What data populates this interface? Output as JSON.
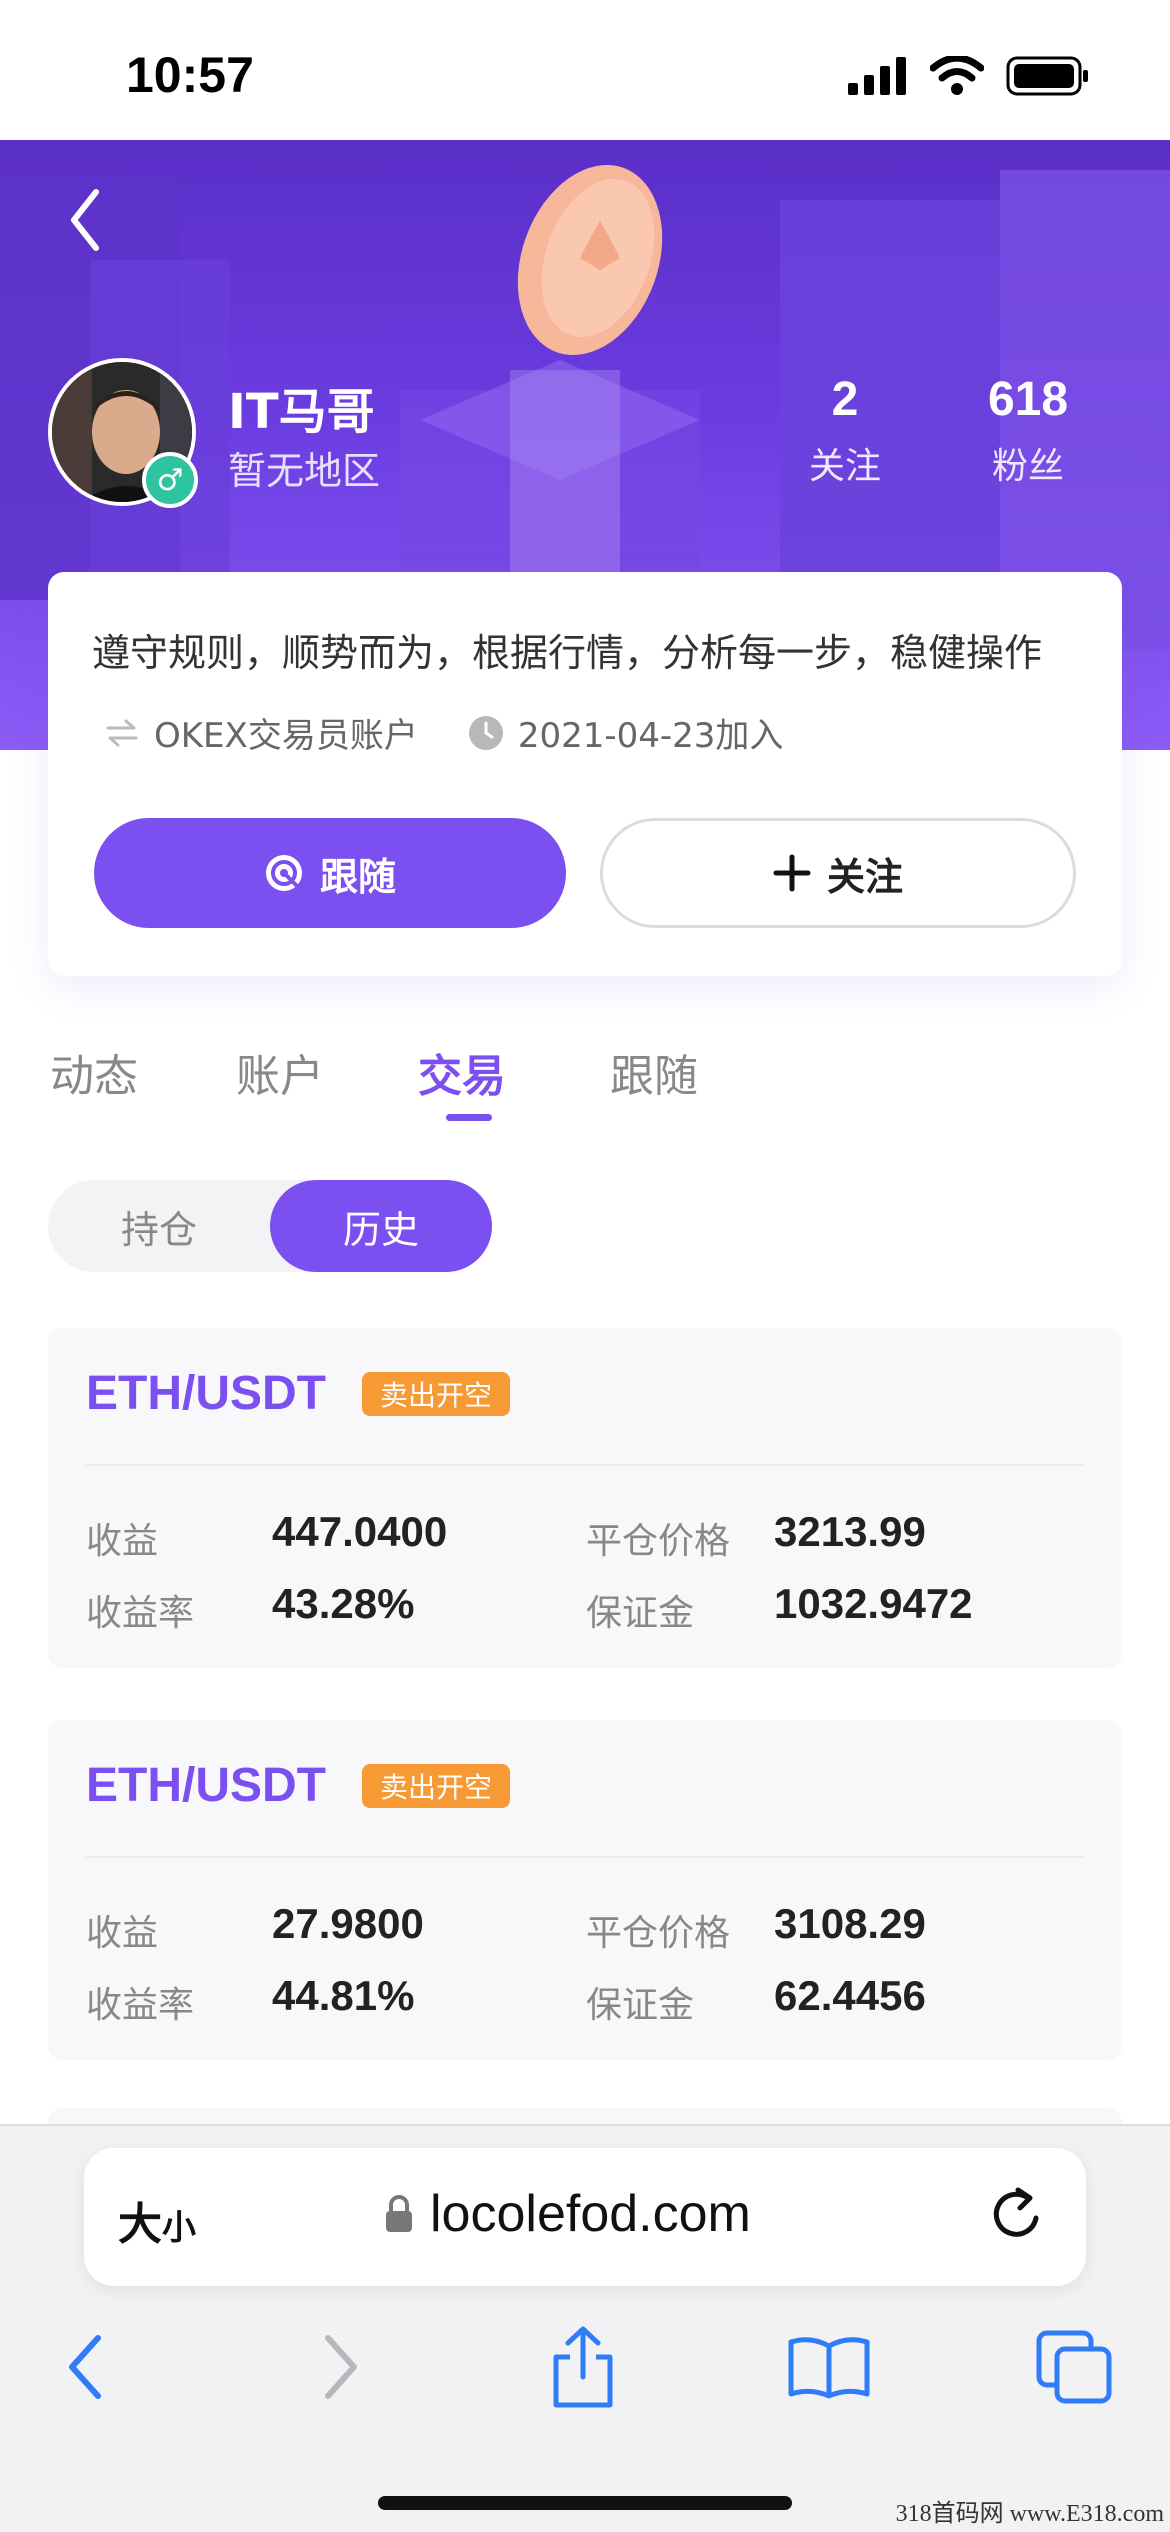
{
  "status_bar": {
    "time": "10:57"
  },
  "profile": {
    "name": "IT马哥",
    "region": "暂无地区",
    "stats": [
      {
        "value": "2",
        "label": "关注"
      },
      {
        "value": "618",
        "label": "粉丝"
      }
    ],
    "bio": "遵守规则，顺势而为，根据行情，分析每一步，稳健操作",
    "account_type": "OKEX交易员账户",
    "joined": "2021-04-23加入",
    "follow_button": "跟随",
    "watch_button": "关注"
  },
  "tabs": [
    {
      "label": "动态"
    },
    {
      "label": "账户"
    },
    {
      "label": "交易"
    },
    {
      "label": "跟随"
    }
  ],
  "active_tab": "交易",
  "segmented": {
    "left": "持仓",
    "right": "历史",
    "active": "历史"
  },
  "trades": [
    {
      "pair": "ETH/USDT",
      "tag": "卖出开空",
      "profit_label": "收益",
      "profit": "447.0400",
      "close_price_label": "平仓价格",
      "close_price": "3213.99",
      "rate_label": "收益率",
      "rate": "43.28%",
      "margin_label": "保证金",
      "margin": "1032.9472"
    },
    {
      "pair": "ETH/USDT",
      "tag": "卖出开空",
      "profit_label": "收益",
      "profit": "27.9800",
      "close_price_label": "平仓价格",
      "close_price": "3108.29",
      "rate_label": "收益率",
      "rate": "44.81%",
      "margin_label": "保证金",
      "margin": "62.4456"
    }
  ],
  "browser": {
    "text_size": "大",
    "text_size_small": "小",
    "url": "locolefod.com"
  },
  "watermark": "318首码网 www.E318.com",
  "colors": {
    "accent": "#7b4ff0",
    "tag": "#f79a35",
    "badge": "#2ec4a0"
  }
}
